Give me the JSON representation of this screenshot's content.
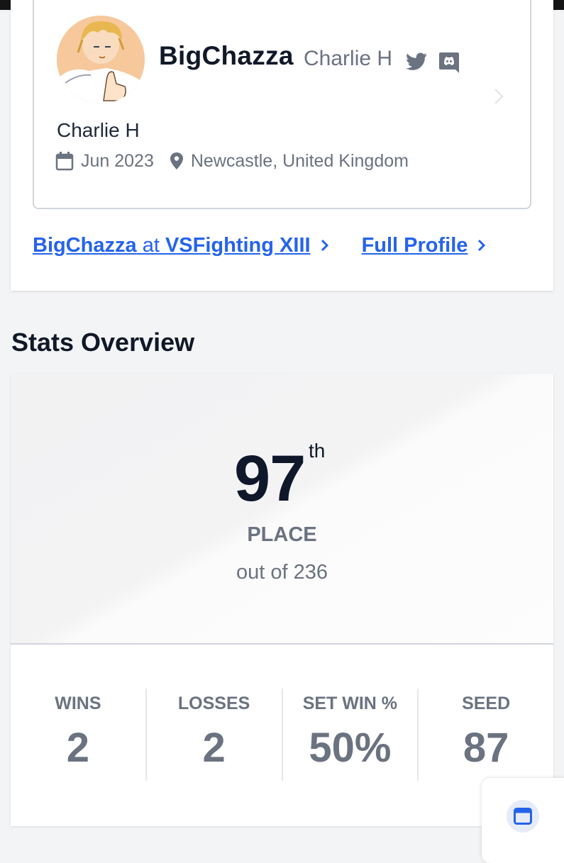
{
  "profile": {
    "gamertag": "BigChazza",
    "display_name": "Charlie H",
    "full_name": "Charlie H",
    "joined": "Jun 2023",
    "location": "Newcastle, United Kingdom",
    "avatar_icon": "avatar-image",
    "social_icons": [
      "twitter-icon",
      "discord-icon"
    ]
  },
  "links": {
    "event_player": "BigChazza",
    "event_at": "at",
    "event_name": "VSFighting XIII",
    "full_profile": "Full Profile"
  },
  "stats": {
    "title": "Stats Overview",
    "placement": "97",
    "placement_suffix": "th",
    "placement_label": "PLACE",
    "out_of": "out of 236",
    "items": [
      {
        "label": "WINS",
        "value": "2"
      },
      {
        "label": "LOSSES",
        "value": "2"
      },
      {
        "label": "SET WIN %",
        "value": "50%"
      },
      {
        "label": "SEED",
        "value": "87"
      }
    ]
  },
  "colors": {
    "link": "#2563eb",
    "muted": "#6b7280",
    "heading": "#111827"
  }
}
